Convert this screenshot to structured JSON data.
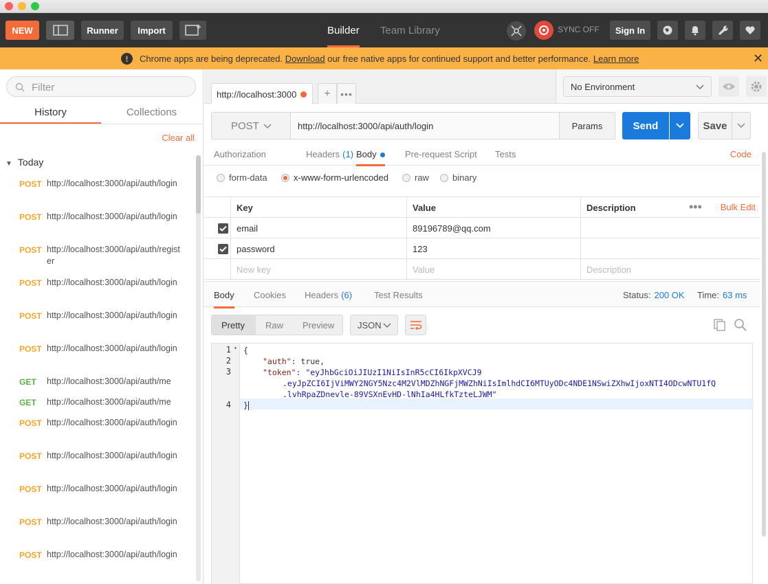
{
  "header": {
    "new_label": "NEW",
    "runner_label": "Runner",
    "import_label": "Import",
    "tabs": [
      "Builder",
      "Team Library"
    ],
    "sync_label": "SYNC OFF",
    "signin_label": "Sign In"
  },
  "banner": {
    "text_before": "Chrome apps are being deprecated.",
    "download_link": "Download",
    "text_after": "our free native apps for continued support and better performance.",
    "learn_more": "Learn more"
  },
  "sidebar": {
    "filter_placeholder": "Filter",
    "tabs": [
      "History",
      "Collections"
    ],
    "clear_all": "Clear all",
    "group": "Today",
    "history": [
      {
        "method": "POST",
        "url": "http://localhost:3000/api/auth/login"
      },
      {
        "method": "POST",
        "url": "http://localhost:3000/api/auth/login"
      },
      {
        "method": "POST",
        "url": "http://localhost:3000/api/auth/register"
      },
      {
        "method": "POST",
        "url": "http://localhost:3000/api/auth/login"
      },
      {
        "method": "POST",
        "url": "http://localhost:3000/api/auth/login"
      },
      {
        "method": "POST",
        "url": "http://localhost:3000/api/auth/login"
      },
      {
        "method": "GET",
        "url": "http://localhost:3000/api/auth/me"
      },
      {
        "method": "GET",
        "url": "http://localhost:3000/api/auth/me"
      },
      {
        "method": "POST",
        "url": "http://localhost:3000/api/auth/login"
      },
      {
        "method": "POST",
        "url": "http://localhost:3000/api/auth/login"
      },
      {
        "method": "POST",
        "url": "http://localhost:3000/api/auth/login"
      },
      {
        "method": "POST",
        "url": "http://localhost:3000/api/auth/login"
      },
      {
        "method": "POST",
        "url": "http://localhost:3000/api/auth/login"
      }
    ]
  },
  "request": {
    "tab_title": "http://localhost:3000",
    "environment": "No Environment",
    "method": "POST",
    "url": "http://localhost:3000/api/auth/login",
    "params_label": "Params",
    "send_label": "Send",
    "save_label": "Save",
    "subtabs": {
      "authorization": "Authorization",
      "headers": "Headers",
      "headers_count": "(1)",
      "body": "Body",
      "prerequest": "Pre-request Script",
      "tests": "Tests"
    },
    "code_label": "Code",
    "body_modes": [
      "form-data",
      "x-www-form-urlencoded",
      "raw",
      "binary"
    ],
    "selected_body_mode": "x-www-form-urlencoded",
    "table": {
      "headers": {
        "key": "Key",
        "value": "Value",
        "description": "Description"
      },
      "bulk_edit": "Bulk Edit",
      "rows": [
        {
          "key": "email",
          "value": "89196789@qq.com",
          "checked": true
        },
        {
          "key": "password",
          "value": "123",
          "checked": true
        }
      ],
      "placeholder": {
        "key": "New key",
        "value": "Value",
        "description": "Description"
      }
    }
  },
  "response": {
    "tabs": {
      "body": "Body",
      "cookies": "Cookies",
      "headers": "Headers",
      "headers_count": "(6)",
      "tests": "Test Results"
    },
    "status_label": "Status:",
    "status_value": "200 OK",
    "time_label": "Time:",
    "time_value": "63 ms",
    "view_modes": [
      "Pretty",
      "Raw",
      "Preview"
    ],
    "format": "JSON",
    "line_numbers": [
      "1",
      "2",
      "3",
      "4"
    ],
    "code": {
      "open": "{",
      "auth_key": "\"auth\"",
      "auth_value": "true",
      "token_key": "\"token\"",
      "token_1": "\"eyJhbGciOiJIUzI1NiIsInR5cCI6IkpXVCJ9",
      "token_2": ".eyJpZCI6IjViMWY2NGY5Nzc4M2VlMDZhNGFjMWZhNiIsImlhdCI6MTUyODc4NDE1NSwiZXhwIjoxNTI4ODcwNTU1fQ",
      "token_3": ".lvhRpaZDnevle-89VSXnEvHD-lNhIa4HLfkTzteLJWM\"",
      "close": "}"
    }
  },
  "colors": {
    "accent": "#f26b3a",
    "primary": "#1a7bdc",
    "post": "#f4a627",
    "get": "#5fb142",
    "banner": "#fab146",
    "header": "#333333"
  }
}
